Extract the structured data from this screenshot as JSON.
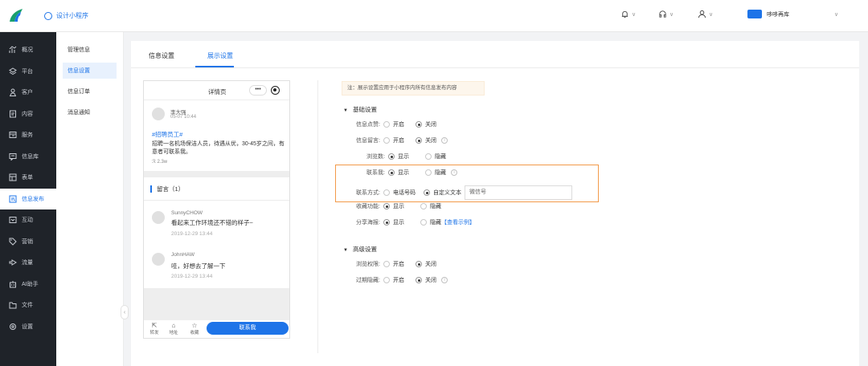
{
  "header": {
    "app_title": "设计小程序",
    "store_name": "哆哆再库"
  },
  "sidebar": {
    "items": [
      {
        "label": "概况",
        "icon": "chart-icon"
      },
      {
        "label": "平台",
        "icon": "layers-icon"
      },
      {
        "label": "客户",
        "icon": "user-icon"
      },
      {
        "label": "内容",
        "icon": "document-icon"
      },
      {
        "label": "服务",
        "icon": "service-icon"
      },
      {
        "label": "信息库",
        "icon": "message-icon"
      },
      {
        "label": "表单",
        "icon": "form-icon"
      },
      {
        "label": "信息发布",
        "icon": "publish-icon",
        "active": true
      },
      {
        "label": "互动",
        "icon": "interact-icon"
      },
      {
        "label": "营销",
        "icon": "tag-icon"
      },
      {
        "label": "流量",
        "icon": "flow-icon"
      },
      {
        "label": "AI助手",
        "icon": "robot-icon"
      },
      {
        "label": "文件",
        "icon": "folder-icon"
      },
      {
        "label": "设置",
        "icon": "gear-icon"
      }
    ]
  },
  "submenu": {
    "items": [
      {
        "label": "管理信息"
      },
      {
        "label": "信息设置",
        "active": true
      },
      {
        "label": "信息订单"
      },
      {
        "label": "消息通知"
      }
    ]
  },
  "tabs": {
    "info_settings": "信息设置",
    "display_settings": "展示设置"
  },
  "preview": {
    "page_title": "详情页",
    "capsule": "•••",
    "author": "李大强",
    "post_time": "05-07 10:44",
    "tag": "#招聘员工#",
    "body": "招聘一名机场保洁人员，待遇从优，30-45岁之间，有意者可联系我。",
    "views": "2.3w",
    "comments_title": "留言（1）",
    "comments": [
      {
        "name": "SunnyCHOW",
        "text": "看起来工作环境还不错的样子~",
        "time": "2019-12-29 13:44"
      },
      {
        "name": "JohnHAW",
        "text": "哇，好想去了解一下",
        "time": "2019-12-29 13:44"
      }
    ],
    "footer": {
      "share": "转发",
      "address": "地址",
      "favorite": "收藏",
      "contact_button": "联系我"
    }
  },
  "settings": {
    "notice": "注：展示设置应用于小程序内所有信息发布内容",
    "basic_title": "基础设置",
    "advanced_title": "高级设置",
    "rows": {
      "like": {
        "label": "信息点赞:",
        "opt1": "开启",
        "opt2": "关闭",
        "selected": "opt2"
      },
      "comment": {
        "label": "信息留言:",
        "opt1": "开启",
        "opt2": "关闭",
        "selected": "opt2"
      },
      "views": {
        "label": "浏览数:",
        "opt1": "显示",
        "opt2": "隐藏",
        "selected": "opt1"
      },
      "contact": {
        "label": "联系我:",
        "opt1": "显示",
        "opt2": "隐藏",
        "selected": "opt1"
      },
      "contact_method": {
        "label": "联系方式:",
        "opt1": "电话号码",
        "opt2": "自定义文本",
        "selected": "opt2",
        "input_value": "微信号"
      },
      "favorite": {
        "label": "收藏功能:",
        "opt1": "显示",
        "opt2": "隐藏",
        "selected": "opt1"
      },
      "poster": {
        "label": "分享海报:",
        "opt1": "显示",
        "opt2": "隐藏",
        "selected": "opt1",
        "link": "【查看示例】"
      },
      "browse_permission": {
        "label": "浏览权限:",
        "opt1": "开启",
        "opt2": "关闭",
        "selected": "opt2"
      },
      "expire_hide": {
        "label": "过期隐藏:",
        "opt1": "开启",
        "opt2": "关闭",
        "selected": "opt2"
      }
    }
  },
  "colors": {
    "accent": "#1e74e8",
    "highlight": "#f29a4a",
    "sidebar_bg": "#1f2329"
  }
}
